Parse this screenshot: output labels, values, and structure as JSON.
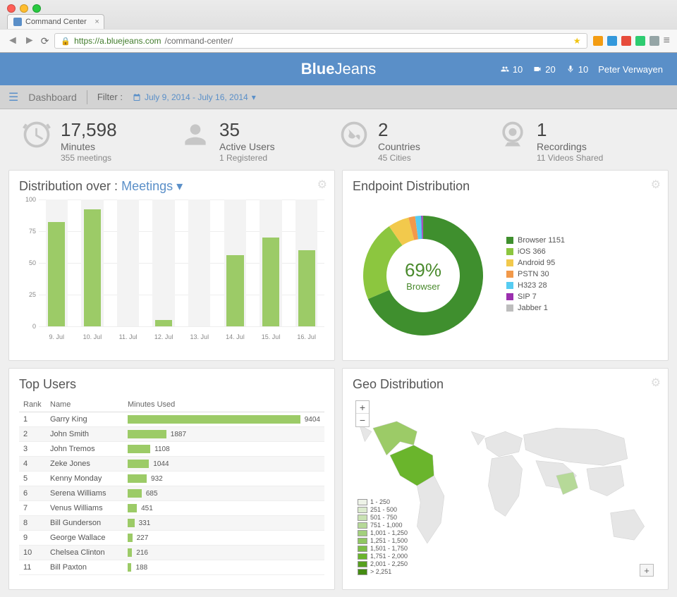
{
  "browser": {
    "tab_title": "Command Center",
    "url_domain": "https://a.bluejeans.com",
    "url_path": "/command-center/"
  },
  "header": {
    "brand_prefix": "Blue",
    "brand_suffix": "Jeans",
    "participants": "10",
    "video": "20",
    "audio": "10",
    "user_name": "Peter Verwayen"
  },
  "toolbar": {
    "title": "Dashboard",
    "filter_label": "Filter :",
    "date_range": "July 9, 2014 - July 16, 2014"
  },
  "stats": [
    {
      "value": "17,598",
      "label": "Minutes",
      "sub": "355 meetings"
    },
    {
      "value": "35",
      "label": "Active Users",
      "sub": "1 Registered"
    },
    {
      "value": "2",
      "label": "Countries",
      "sub": "45 Cities"
    },
    {
      "value": "1",
      "label": "Recordings",
      "sub": "11 Videos Shared"
    }
  ],
  "distribution": {
    "title_prefix": "Distribution over :",
    "dropdown": "Meetings"
  },
  "endpoint": {
    "title": "Endpoint Distribution",
    "center_pct": "69%",
    "center_label": "Browser",
    "legend": [
      {
        "name": "Browser 1151",
        "color": "#3f8f2e"
      },
      {
        "name": "iOS 366",
        "color": "#8cc63f"
      },
      {
        "name": "Android 95",
        "color": "#f2c94c"
      },
      {
        "name": "PSTN 30",
        "color": "#f2994a"
      },
      {
        "name": "H323 28",
        "color": "#56ccf2"
      },
      {
        "name": "SIP 7",
        "color": "#9b2fae"
      },
      {
        "name": "Jabber 1",
        "color": "#bdbdbd"
      }
    ]
  },
  "top_users": {
    "title": "Top Users",
    "cols": {
      "rank": "Rank",
      "name": "Name",
      "minutes": "Minutes Used"
    },
    "rows": [
      {
        "rank": 1,
        "name": "Garry King",
        "minutes": 9404
      },
      {
        "rank": 2,
        "name": "John Smith",
        "minutes": 1887
      },
      {
        "rank": 3,
        "name": "John Tremos",
        "minutes": 1108
      },
      {
        "rank": 4,
        "name": "Zeke Jones",
        "minutes": 1044
      },
      {
        "rank": 5,
        "name": "Kenny Monday",
        "minutes": 932
      },
      {
        "rank": 6,
        "name": "Serena Williams",
        "minutes": 685
      },
      {
        "rank": 7,
        "name": "Venus Williams",
        "minutes": 451
      },
      {
        "rank": 8,
        "name": "Bill Gunderson",
        "minutes": 331
      },
      {
        "rank": 9,
        "name": "George Wallace",
        "minutes": 227
      },
      {
        "rank": 10,
        "name": "Chelsea Clinton",
        "minutes": 216
      },
      {
        "rank": 11,
        "name": "Bill Paxton",
        "minutes": 188
      }
    ]
  },
  "geo": {
    "title": "Geo Distribution",
    "legend": [
      {
        "range": "1 - 250",
        "color": "#eef3e8"
      },
      {
        "range": "251 - 500",
        "color": "#dcebce"
      },
      {
        "range": "501 - 750",
        "color": "#c9e2b3"
      },
      {
        "range": "751 - 1,000",
        "color": "#b6d998"
      },
      {
        "range": "1,001 - 1,250",
        "color": "#a3d07d"
      },
      {
        "range": "1,251 - 1,500",
        "color": "#90c762"
      },
      {
        "range": "1,501 - 1,750",
        "color": "#7dbe47"
      },
      {
        "range": "1,751 - 2,000",
        "color": "#6ab52c"
      },
      {
        "range": "2,001 - 2,250",
        "color": "#57a01f"
      },
      {
        "range": "> 2,251",
        "color": "#448b12"
      }
    ]
  },
  "chart_data": [
    {
      "type": "bar",
      "title": "Distribution over Meetings",
      "categories": [
        "9. Jul",
        "10. Jul",
        "11. Jul",
        "12. Jul",
        "13. Jul",
        "14. Jul",
        "15. Jul",
        "16. Jul"
      ],
      "values": [
        82,
        92,
        0,
        5,
        0,
        56,
        70,
        60
      ],
      "ylim": [
        0,
        100
      ],
      "yticks": [
        0,
        25,
        50,
        75,
        100
      ]
    },
    {
      "type": "pie",
      "title": "Endpoint Distribution",
      "series": [
        {
          "name": "Browser",
          "value": 1151,
          "color": "#3f8f2e"
        },
        {
          "name": "iOS",
          "value": 366,
          "color": "#8cc63f"
        },
        {
          "name": "Android",
          "value": 95,
          "color": "#f2c94c"
        },
        {
          "name": "PSTN",
          "value": 30,
          "color": "#f2994a"
        },
        {
          "name": "H323",
          "value": 28,
          "color": "#56ccf2"
        },
        {
          "name": "SIP",
          "value": 7,
          "color": "#9b2fae"
        },
        {
          "name": "Jabber",
          "value": 1,
          "color": "#bdbdbd"
        }
      ]
    }
  ]
}
